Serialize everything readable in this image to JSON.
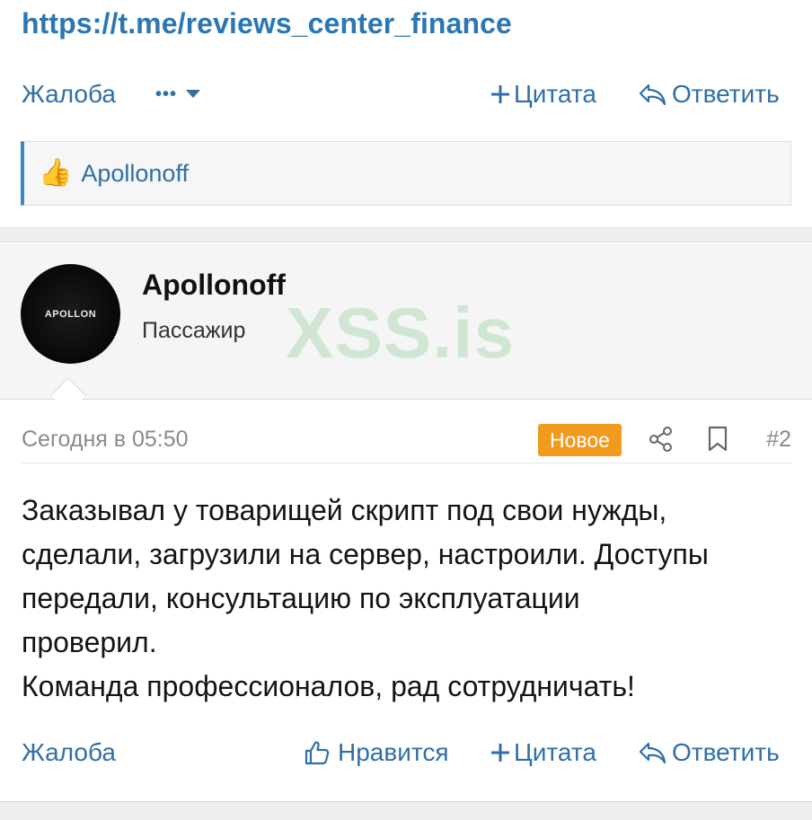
{
  "top_link": "https://t.me/reviews_center_finance",
  "actions_top": {
    "report": "Жалоба",
    "more": "•••",
    "quote": "Цитата",
    "reply": "Ответить"
  },
  "reactions": {
    "emoji": "👍",
    "user": "Apollonoff"
  },
  "post": {
    "author": "Apollonoff",
    "author_title": "Пассажир",
    "avatar_text": "APOLLON",
    "watermark": "XSS.is",
    "date": "Сегодня в 05:50",
    "badge": "Новое",
    "number": "#2",
    "body_lines": [
      "Заказывал у товарищей скрипт под свои нужды,",
      "сделали, загрузили на сервер, настроили. Доступы",
      "передали, консультацию по эксплуатации",
      "проверил.",
      "Команда профессионалов, рад сотрудничать!"
    ]
  },
  "actions_bottom": {
    "report": "Жалоба",
    "like": "Нравится",
    "quote": "Цитата",
    "reply": "Ответить"
  },
  "colors": {
    "link": "#2a77b4",
    "action": "#2f6fa8",
    "badge": "#f29a1e",
    "reaction_bar_accent": "#3a87c6",
    "watermark": "#6ebe78"
  },
  "icons": [
    "plus-icon",
    "reply-icon",
    "chevron-down-icon",
    "thumbs-up-icon",
    "share-icon",
    "bookmark-icon",
    "like-icon"
  ]
}
